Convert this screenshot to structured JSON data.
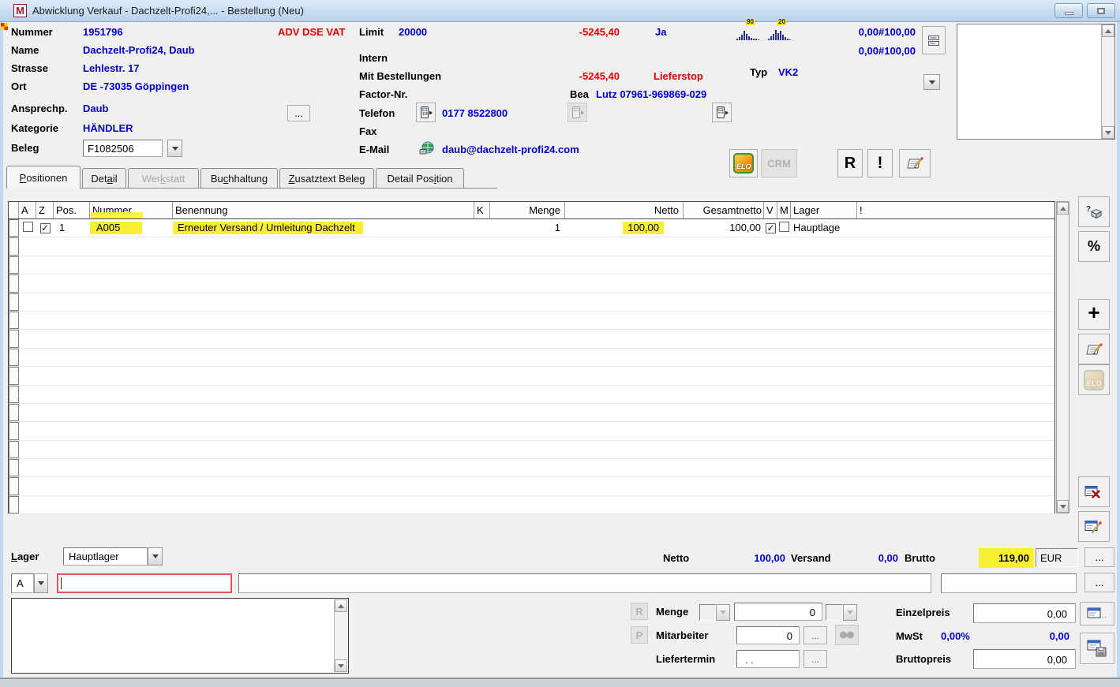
{
  "window": {
    "title": "Abwicklung Verkauf - Dachzelt-Profi24,... - Bestellung (Neu)",
    "icon_letter": "M",
    "minimize": "minimize",
    "restore": "restore"
  },
  "colors": {
    "value_blue": "#0000cc",
    "alert_red": "#e60000",
    "highlight_yellow": "#f8ef35"
  },
  "header": {
    "adv_flags": "ADV DSE VAT",
    "fields": {
      "nummer": {
        "label": "Nummer",
        "value": "1951796"
      },
      "name": {
        "label": "Name",
        "value": "Dachzelt-Profi24, Daub"
      },
      "strasse": {
        "label": "Strasse",
        "value": "Lehlestr. 17"
      },
      "ort": {
        "label": "Ort",
        "value": "DE -73035 Göppingen"
      },
      "ansprechp": {
        "label": "Ansprechp.",
        "value": "Daub"
      },
      "kategorie": {
        "label": "Kategorie",
        "value": "HÄNDLER"
      },
      "beleg": {
        "label": "Beleg",
        "value": "F1082506"
      }
    },
    "more_button": "...",
    "limit": {
      "label": "Limit",
      "value": "20000",
      "saldo": "-5245,40",
      "flag": "Ja"
    },
    "intern_label": "Intern",
    "mit_bestellungen": {
      "label": "Mit Bestellungen",
      "saldo": "-5245,40",
      "status": "Lieferstop"
    },
    "factor_label": "Factor-Nr.",
    "bea": {
      "label": "Bea",
      "value": "Lutz 07961-969869-029"
    },
    "typ": {
      "label": "Typ",
      "value": "VK2"
    },
    "telefon": {
      "label": "Telefon",
      "value": "0177 8522800"
    },
    "fax_label": "Fax",
    "email": {
      "label": "E-Mail",
      "value": "daub@dachzelt-profi24.com"
    },
    "stats": {
      "line1": "0,00#100,00",
      "line2": "0,00#100,00"
    },
    "charts": [
      {
        "label": "90",
        "bars": [
          2,
          4,
          7,
          12,
          8,
          5,
          3,
          2,
          2,
          1
        ]
      },
      {
        "label": "20",
        "bars": [
          2,
          5,
          8,
          13,
          9,
          12,
          7,
          4,
          2,
          1
        ]
      }
    ]
  },
  "toolbar": {
    "elo": "ELO",
    "crm": "CRM",
    "r": "R",
    "warn": "!"
  },
  "tabs": [
    {
      "label": "Positionen",
      "underline": 0,
      "state": "active"
    },
    {
      "label": "Detail",
      "underline": 3,
      "state": "normal"
    },
    {
      "label": "Werkstatt",
      "underline": 3,
      "state": "disabled"
    },
    {
      "label": "Buchhaltung",
      "underline": 2,
      "state": "normal"
    },
    {
      "label": "Zusatztext Beleg",
      "underline": 0,
      "state": "normal"
    },
    {
      "label": "Detail Position",
      "underline": 10,
      "state": "normal"
    }
  ],
  "table": {
    "columns": [
      "A",
      "Z",
      "Pos.",
      "Nummer",
      "Benennung",
      "K",
      "Menge",
      "Netto",
      "Gesamtnetto",
      "V",
      "M",
      "Lager",
      "!"
    ],
    "row": {
      "a_checked": false,
      "z_checked": true,
      "pos": "1",
      "nummer": "A005",
      "benennung": "Erneuter Versand / Umleitung Dachzelt",
      "k": "",
      "menge": "1",
      "netto": "100,00",
      "gesamtnetto": "100,00",
      "v_checked": true,
      "m_checked": false,
      "lager": "Hauptlage",
      "excl": ""
    },
    "empty_rows": 15
  },
  "footer": {
    "lager": {
      "label": "Lager",
      "underline": 0,
      "value": "Hauptlager"
    },
    "totals": {
      "netto_label": "Netto",
      "netto": "100,00",
      "versand_label": "Versand",
      "versand": "0,00",
      "brutto_label": "Brutto",
      "brutto": "119,00",
      "currency": "EUR"
    },
    "pos_type": "A",
    "more_button": "...",
    "detail": {
      "r": "R",
      "p": "P",
      "menge_label": "Menge",
      "menge": "0",
      "mitarbeiter_label": "Mitarbeiter",
      "mitarbeiter": "0",
      "liefertermin_label": "Liefertermin",
      "liefertermin": ". .",
      "einzelpreis_label": "Einzelpreis",
      "einzelpreis": "0,00",
      "mwst_label": "MwSt",
      "mwst_rate": "0,00%",
      "mwst_value": "0,00",
      "bruttopreis_label": "Bruttopreis",
      "bruttopreis": "0,00"
    }
  }
}
